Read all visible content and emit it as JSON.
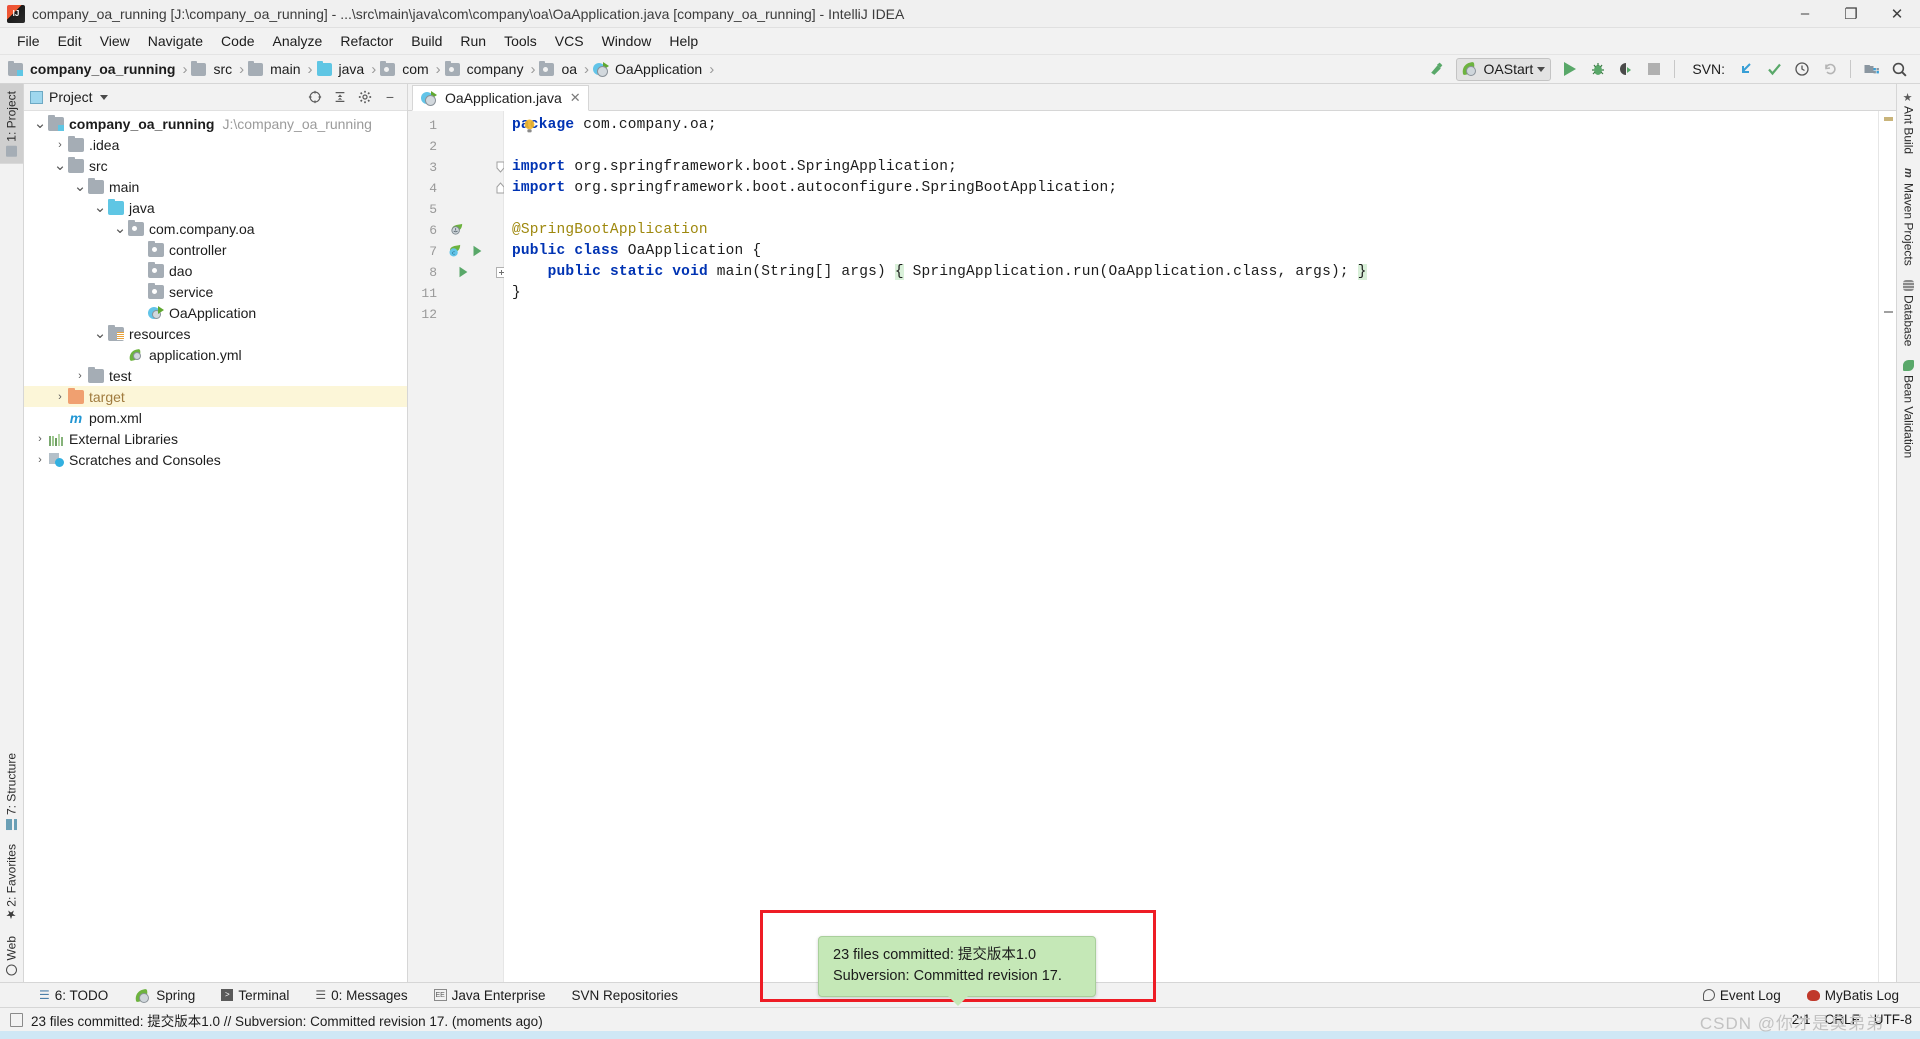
{
  "window": {
    "title": "company_oa_running [J:\\company_oa_running] - ...\\src\\main\\java\\com\\company\\oa\\OaApplication.java [company_oa_running] - IntelliJ IDEA",
    "minimize": "–",
    "maximize": "❐",
    "close": "✕"
  },
  "menubar": {
    "items": [
      "File",
      "Edit",
      "View",
      "Navigate",
      "Code",
      "Analyze",
      "Refactor",
      "Build",
      "Run",
      "Tools",
      "VCS",
      "Window",
      "Help"
    ]
  },
  "breadcrumb": {
    "items": [
      {
        "label": "company_oa_running",
        "icon": "module-icon",
        "bold": true
      },
      {
        "label": "src",
        "icon": "folder-icon",
        "bold": false
      },
      {
        "label": "main",
        "icon": "folder-icon",
        "bold": false
      },
      {
        "label": "java",
        "icon": "source-folder-icon",
        "bold": false
      },
      {
        "label": "com",
        "icon": "package-icon",
        "bold": false
      },
      {
        "label": "company",
        "icon": "package-icon",
        "bold": false
      },
      {
        "label": "oa",
        "icon": "package-icon",
        "bold": false
      },
      {
        "label": "OaApplication",
        "icon": "spring-class-icon",
        "bold": false
      }
    ],
    "separator": "›"
  },
  "toolbar": {
    "build_icon": "hammer-icon",
    "run_config": "OAStart",
    "run_icon": "run-icon",
    "debug_icon": "debug-icon",
    "run_coverage_icon": "run-with-coverage-icon",
    "stop_icon": "stop-icon",
    "svn_label": "SVN:",
    "update_icon": "svn-update-icon",
    "commit_icon": "svn-commit-icon",
    "history_icon": "svn-history-icon",
    "revert_icon": "svn-revert-icon",
    "settings_icon": "project-structure-icon",
    "search_icon": "search-everywhere-icon"
  },
  "left_stripe": {
    "top": [
      {
        "label": "1: Project",
        "icon": "project-icon",
        "active": true
      }
    ],
    "bottom": [
      {
        "label": "7: Structure",
        "icon": "structure-icon"
      },
      {
        "label": "2: Favorites",
        "icon": "star-icon"
      },
      {
        "label": "Web",
        "icon": "web-icon"
      }
    ]
  },
  "right_stripe": {
    "items": [
      {
        "label": "Ant Build",
        "icon": "ant-icon"
      },
      {
        "label": "Maven Projects",
        "icon": "maven-icon"
      },
      {
        "label": "Database",
        "icon": "database-icon"
      },
      {
        "label": "Bean Validation",
        "icon": "bean-validation-icon"
      }
    ]
  },
  "project_panel": {
    "title": "Project",
    "dropdown_icon": "chevron-down-icon",
    "tools": [
      "collapse-target-icon",
      "collapse-all-icon",
      "settings-gear-icon",
      "hide-icon"
    ],
    "tree": [
      {
        "indent": 0,
        "twisty": "⌄",
        "icon": "module-icon",
        "label": "company_oa_running",
        "bold": true,
        "path": "J:\\company_oa_running",
        "highlight": false
      },
      {
        "indent": 1,
        "twisty": "›",
        "icon": "folder-icon",
        "label": ".idea",
        "bold": false,
        "path": "",
        "highlight": false
      },
      {
        "indent": 1,
        "twisty": "⌄",
        "icon": "folder-icon",
        "label": "src",
        "bold": false,
        "path": "",
        "highlight": false
      },
      {
        "indent": 2,
        "twisty": "⌄",
        "icon": "folder-icon",
        "label": "main",
        "bold": false,
        "path": "",
        "highlight": false
      },
      {
        "indent": 3,
        "twisty": "⌄",
        "icon": "source-folder-icon",
        "label": "java",
        "bold": false,
        "path": "",
        "highlight": false
      },
      {
        "indent": 4,
        "twisty": "⌄",
        "icon": "package-icon",
        "label": "com.company.oa",
        "bold": false,
        "path": "",
        "highlight": false
      },
      {
        "indent": 5,
        "twisty": "",
        "icon": "package-icon",
        "label": "controller",
        "bold": false,
        "path": "",
        "highlight": false
      },
      {
        "indent": 5,
        "twisty": "",
        "icon": "package-icon",
        "label": "dao",
        "bold": false,
        "path": "",
        "highlight": false
      },
      {
        "indent": 5,
        "twisty": "",
        "icon": "package-icon",
        "label": "service",
        "bold": false,
        "path": "",
        "highlight": false
      },
      {
        "indent": 5,
        "twisty": "",
        "icon": "spring-class-icon",
        "label": "OaApplication",
        "bold": false,
        "path": "",
        "highlight": false
      },
      {
        "indent": 3,
        "twisty": "⌄",
        "icon": "resources-icon",
        "label": "resources",
        "bold": false,
        "path": "",
        "highlight": false
      },
      {
        "indent": 4,
        "twisty": "",
        "icon": "spring-yml-icon",
        "label": "application.yml",
        "bold": false,
        "path": "",
        "highlight": false
      },
      {
        "indent": 2,
        "twisty": "›",
        "icon": "folder-icon",
        "label": "test",
        "bold": false,
        "path": "",
        "highlight": false
      },
      {
        "indent": 1,
        "twisty": "›",
        "icon": "target-folder-icon",
        "label": "target",
        "bold": false,
        "path": "",
        "highlight": true
      },
      {
        "indent": 1,
        "twisty": "",
        "icon": "maven-file-icon",
        "label": "pom.xml",
        "bold": false,
        "path": "",
        "highlight": false
      },
      {
        "indent": 0,
        "twisty": "›",
        "icon": "libraries-icon",
        "label": "External Libraries",
        "bold": false,
        "path": "",
        "highlight": false
      },
      {
        "indent": 0,
        "twisty": "›",
        "icon": "scratches-icon",
        "label": "Scratches and Consoles",
        "bold": false,
        "path": "",
        "highlight": false
      }
    ]
  },
  "editor": {
    "tab": {
      "label": "OaApplication.java",
      "icon": "spring-class-icon",
      "close": "✕"
    },
    "line_numbers": [
      "1",
      "2",
      "3",
      "4",
      "5",
      "6",
      "7",
      "8",
      "11",
      "12"
    ],
    "code_lines": [
      "package com.company.oa;",
      "",
      "import org.springframework.boot.SpringApplication;",
      "import org.springframework.boot.autoconfigure.SpringBootApplication;",
      "",
      "@SpringBootApplication",
      "public class OaApplication {",
      "    public static void main(String[] args) { SpringApplication.run(OaApplication.class, args); }",
      "}",
      ""
    ],
    "gutter_icons": [
      {
        "line": 6,
        "icon": "spring-bean-icon"
      },
      {
        "line": 7,
        "icon": "spring-config-class-icon"
      },
      {
        "line": 7,
        "icon": "run-gutter-icon"
      },
      {
        "line": 8,
        "icon": "run-gutter-icon"
      }
    ],
    "intention_icon": "intention-bulb-icon"
  },
  "notification": {
    "line1": "23 files committed: 提交版本1.0",
    "line2": "Subversion: Committed revision 17."
  },
  "toolwindow_bar": {
    "left": [
      {
        "label": "6: TODO",
        "mnemonic": "6",
        "icon": "todo-icon"
      },
      {
        "label": "Spring",
        "mnemonic": "",
        "icon": "spring-icon"
      },
      {
        "label": "Terminal",
        "mnemonic": "",
        "icon": "terminal-icon"
      },
      {
        "label": "0: Messages",
        "mnemonic": "0",
        "icon": "messages-icon"
      },
      {
        "label": "Java Enterprise",
        "mnemonic": "",
        "icon": "java-ee-icon"
      },
      {
        "label": "SVN Repositories",
        "mnemonic": "",
        "icon": ""
      }
    ],
    "right": [
      {
        "label": "Event Log",
        "icon": "event-log-icon"
      },
      {
        "label": "MyBatis Log",
        "icon": "mybatis-icon"
      }
    ]
  },
  "statusbar": {
    "icon": "status-message-icon",
    "message": "23 files committed: 提交版本1.0 // Subversion: Committed revision 17. (moments ago)",
    "position": "2:1",
    "line_separator": "CRLF",
    "encoding": "UTF-8",
    "watermark": "CSDN @你才是臭弟弟"
  },
  "colors": {
    "accent_green": "#59a869",
    "notification_bg": "#c5e8b7",
    "highlight_row": "#fcf6d8",
    "keyword_blue": "#0033b3",
    "annotation_gold": "#9e880d",
    "redbox": "#ee1c25"
  }
}
